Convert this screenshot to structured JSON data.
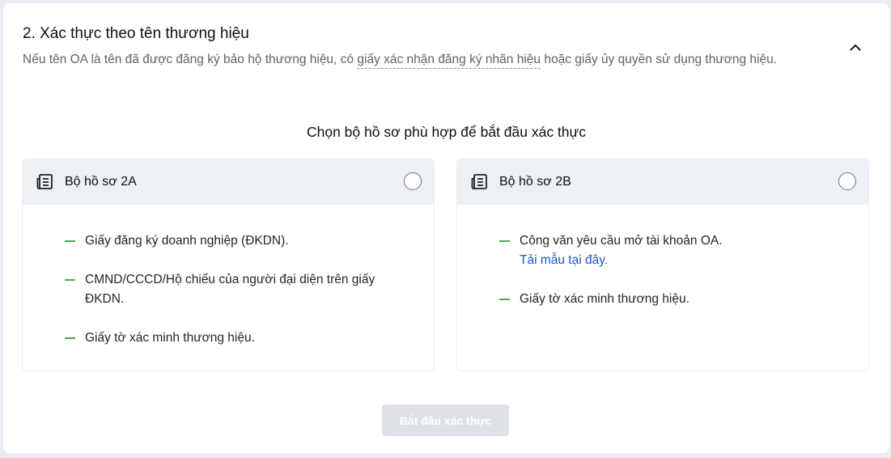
{
  "section": {
    "title": "2. Xác thực theo tên thương hiệu",
    "description_prefix": "Nếu tên OA là tên đã được đăng ký bảo hộ thương hiệu, có ",
    "description_link": "giấy xác nhận đăng ký nhãn hiệu",
    "description_suffix": " hoặc giấy ủy quyền sử dụng thương hiệu.",
    "collapse_icon": "chevron-up-icon"
  },
  "prompt": "Chọn bộ hồ sơ phù hợp để bắt đầu xác thực",
  "cards": [
    {
      "icon": "document-icon",
      "title": "Bộ hồ sơ 2A",
      "selected": false,
      "items": [
        "Giấy đăng ký doanh nghiệp (ĐKDN).",
        "CMND/CCCD/Hộ chiếu của người đại diện trên giấy ĐKDN.",
        "Giấy tờ xác minh thương hiệu."
      ]
    },
    {
      "icon": "document-icon",
      "title": "Bộ hồ sơ 2B",
      "selected": false,
      "items": [
        "Công văn yêu cầu mở tài khoản OA.",
        "Giấy tờ xác minh thương hiệu."
      ],
      "item_link": "Tải mẫu tại đây."
    }
  ],
  "start_button": {
    "label": "Bắt đầu xác thực",
    "disabled": true
  },
  "colors": {
    "accent_green": "#4caf50",
    "link_blue": "#1f56c4",
    "card_header_bg": "#edf0f4",
    "disabled_button_bg": "#dee1e6"
  }
}
